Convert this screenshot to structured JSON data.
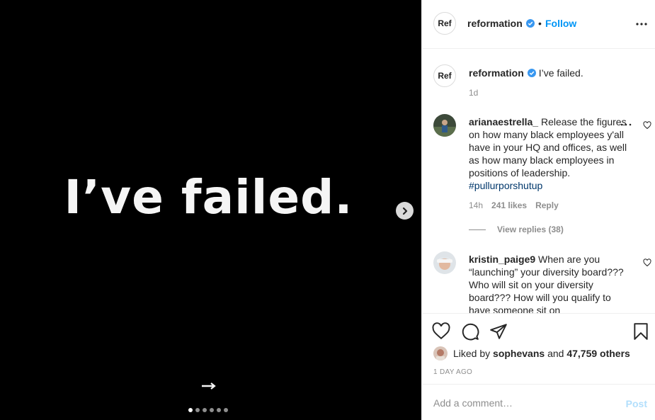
{
  "media": {
    "headline": "I’ve failed.",
    "dots_count": 6,
    "active_dot": 0
  },
  "header": {
    "avatar_text": "Ref",
    "username": "reformation",
    "separator": "•",
    "follow_label": "Follow"
  },
  "caption": {
    "avatar_text": "Ref",
    "username": "reformation",
    "text": "I’ve failed.",
    "time": "1d"
  },
  "comments": [
    {
      "username": "arianaestrella_",
      "text": "Release the figures on how many black employees y'all have in your HQ and offices, as well as how many black employees in positions of leadership.",
      "hashtag": "#pullurporshutup",
      "time": "14h",
      "likes": "241 likes",
      "reply_label": "Reply",
      "view_replies": "View replies (38)"
    },
    {
      "username": "kristin_paige9",
      "text": "When are you “launching” your diversity board??? Who will sit on your diversity board??? How will you qualify to have someone sit on"
    }
  ],
  "likes": {
    "prefix": "Liked by",
    "user": "sophevans",
    "conjunction": "and",
    "others": "47,759 others"
  },
  "time_ago": "1 DAY AGO",
  "comment_input": {
    "placeholder": "Add a comment…",
    "value": ""
  },
  "post_label": "Post",
  "colors": {
    "accent": "#0095f6",
    "verified": "#3897f0",
    "post_disabled": "#b2dffc",
    "muted": "#8e8e8e"
  }
}
